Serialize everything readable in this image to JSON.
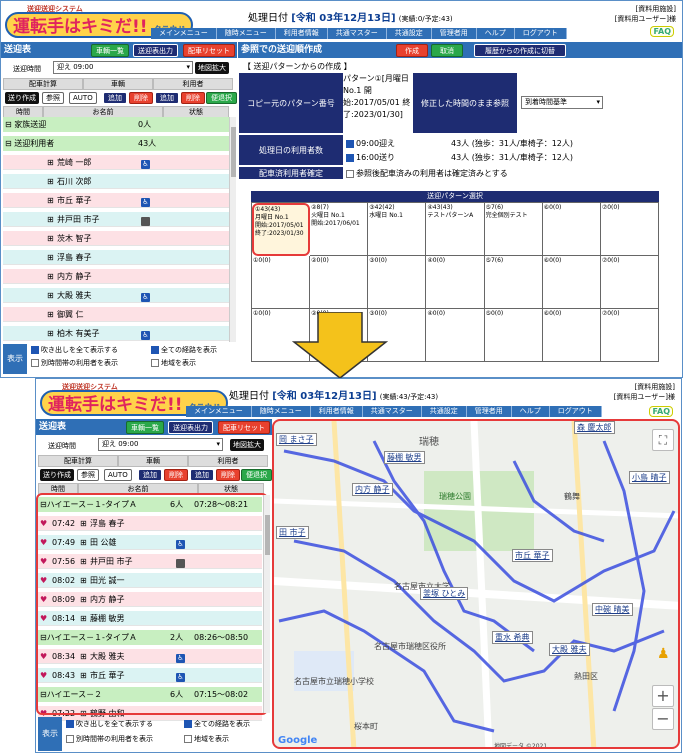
{
  "app": {
    "subtitle": "送迎送迎システム",
    "logo": "運転手はキミだ!!",
    "logo_sub": "クラウド",
    "faq": "FAQ",
    "user_line1": "[資料用施設]",
    "user_line2": "[資料用ユーザー]様",
    "proc_label": "処理日付",
    "proc_date": "[令和 03年12月13日]",
    "status_top": "(実績:0/予定:43)",
    "status_bottom": "(実績:43/予定:43)",
    "menu": [
      "メインメニュー",
      "随時メニュー",
      "利用者情報",
      "共通マスター",
      "共通設定",
      "管理者用",
      "ヘルプ",
      "ログアウト"
    ]
  },
  "left": {
    "title": "送迎表",
    "btn_vehicles": "車輌一覧",
    "btn_print": "送迎表出力",
    "btn_reset": "配車リセット",
    "trip_label": "送迎時間",
    "trip_value": "迎え 09:00",
    "btn_map": "地図拡大",
    "h_calc": "配車計算",
    "h_vehicle": "車輌",
    "h_user": "利用者",
    "btn_create": "送り作成",
    "btn_ref": "参照",
    "btn_auto": "AUTO",
    "btn_add": "追加",
    "btn_del": "削除",
    "btn_add2": "追加",
    "btn_del2": "削除",
    "btn_conv": "便退択",
    "col_time": "時間",
    "col_name": "お名前",
    "col_state": "状態",
    "display": "表示",
    "opt_balloon": "吹き出しを全て表示する",
    "opt_route": "全ての経路を表示",
    "opt_other": "別時間帯の利用者を表示",
    "opt_area": "地域を表示"
  },
  "top_list": [
    {
      "kind": "grp",
      "name": "家族送迎",
      "count": "0人"
    },
    {
      "kind": "grp",
      "name": "送迎利用者",
      "count": "43人"
    },
    {
      "kind": "p",
      "name": "荒崎 一郎",
      "icon": "wheelchair"
    },
    {
      "kind": "c",
      "name": "石川 次郎",
      "icon": ""
    },
    {
      "kind": "p",
      "name": "市丘 華子",
      "icon": "wheelchair"
    },
    {
      "kind": "c",
      "name": "井戸田 市子",
      "icon": "walker"
    },
    {
      "kind": "p",
      "name": "茨木 智子",
      "icon": ""
    },
    {
      "kind": "c",
      "name": "浮島 春子",
      "icon": ""
    },
    {
      "kind": "p",
      "name": "内方 静子",
      "icon": ""
    },
    {
      "kind": "c",
      "name": "大殿 雅夫",
      "icon": "wheelchair"
    },
    {
      "kind": "p",
      "name": "御翼 仁",
      "icon": ""
    },
    {
      "kind": "c",
      "name": "柏木 有美子",
      "icon": "wheelchair"
    }
  ],
  "bottom_list": [
    {
      "kind": "grp",
      "name": "ハイエース－１-タイプＡ",
      "count": "6人",
      "range": "07:28～08:21"
    },
    {
      "kind": "p",
      "time": "07:42",
      "name": "浮島 春子",
      "icon": ""
    },
    {
      "kind": "c",
      "time": "07:49",
      "name": "田 公雄",
      "icon": "wheelchair"
    },
    {
      "kind": "p",
      "time": "07:56",
      "name": "井戸田 市子",
      "icon": "walker"
    },
    {
      "kind": "c",
      "time": "08:02",
      "name": "田光 誠一",
      "icon": ""
    },
    {
      "kind": "p",
      "time": "08:09",
      "name": "内方 静子",
      "icon": ""
    },
    {
      "kind": "c",
      "time": "08:14",
      "name": "藤棚 敏男",
      "icon": ""
    },
    {
      "kind": "grp",
      "name": "ハイエース－１-タイプＡ",
      "count": "2人",
      "range": "08:26～08:50"
    },
    {
      "kind": "p",
      "time": "08:34",
      "name": "大殿 雅夫",
      "icon": "wheelchair"
    },
    {
      "kind": "c",
      "time": "08:43",
      "name": "市丘 華子",
      "icon": "wheelchair"
    },
    {
      "kind": "grp",
      "name": "ハイエース－２",
      "count": "6人",
      "range": "07:15～08:02"
    },
    {
      "kind": "p",
      "time": "07:22",
      "name": "鶴野 由和",
      "icon": ""
    }
  ],
  "ref": {
    "title": "参照での送迎順作成",
    "btn_create": "作成",
    "btn_cancel": "取消",
    "btn_history": "履歴からの作成に切替",
    "section": "【 送迎パターンからの作成 】",
    "copy_label": "コピー元のパターン番号",
    "pattern_text": "パターン①[月曜日No.1 開始:2017/05/01 終了:2023/01/30]",
    "keep_label": "修正した時間のまま参照",
    "keep_value": "到着時間基準",
    "day_label": "処理日の利用者数",
    "trip1": "09:00迎え",
    "trip1_info": "43人 (独歩：31人/車椅子：12人)",
    "trip2": "16:00送り",
    "trip2_info": "43人 (独歩：31人/車椅子：12人)",
    "confirm_label": "配車済利用者確定",
    "confirm_text": "参照後配車済みの利用者は確定済みとする",
    "grid_title": "送迎パターン選択",
    "cells": [
      "①43(43)\n月曜日 No.1\n開始:2017/05/01\n終了:2023/01/30",
      "②8(7)\n火曜日 No.1\n開始:2017/06/01",
      "③42(42)\n水曜日 No.1",
      "④43(43)\nテストパターンA",
      "⑤7(6)\n完全個別テスト",
      "⑥0(0)",
      "⑦0(0)",
      "①0(0)",
      "②0(0)",
      "③0(0)",
      "④0(0)",
      "⑤7(6)",
      "⑥0(0)",
      "⑦0(0)",
      "①0(0)",
      "②0(0)",
      "③0(0)",
      "④0(0)",
      "⑤0(0)",
      "⑥0(0)",
      "⑦0(0)"
    ]
  },
  "map": {
    "tags": [
      "岡 まさ子",
      "藤棚 敏男",
      "内方 静子",
      "田 市子",
      "市丘 華子",
      "釜塚 ひとみ",
      "中碗 晴美",
      "重水 希典",
      "大殿 雅夫",
      "森 慶太郎",
      "小島 晴子"
    ],
    "places": [
      "瑞穂",
      "瑞穂公園",
      "名古屋市立大学",
      "名古屋市瑞穂区役所",
      "桜本町",
      "鶴舞",
      "熱田区",
      "名古屋市立瑞穂小学校"
    ],
    "copyright": "地図データ ©2021"
  }
}
